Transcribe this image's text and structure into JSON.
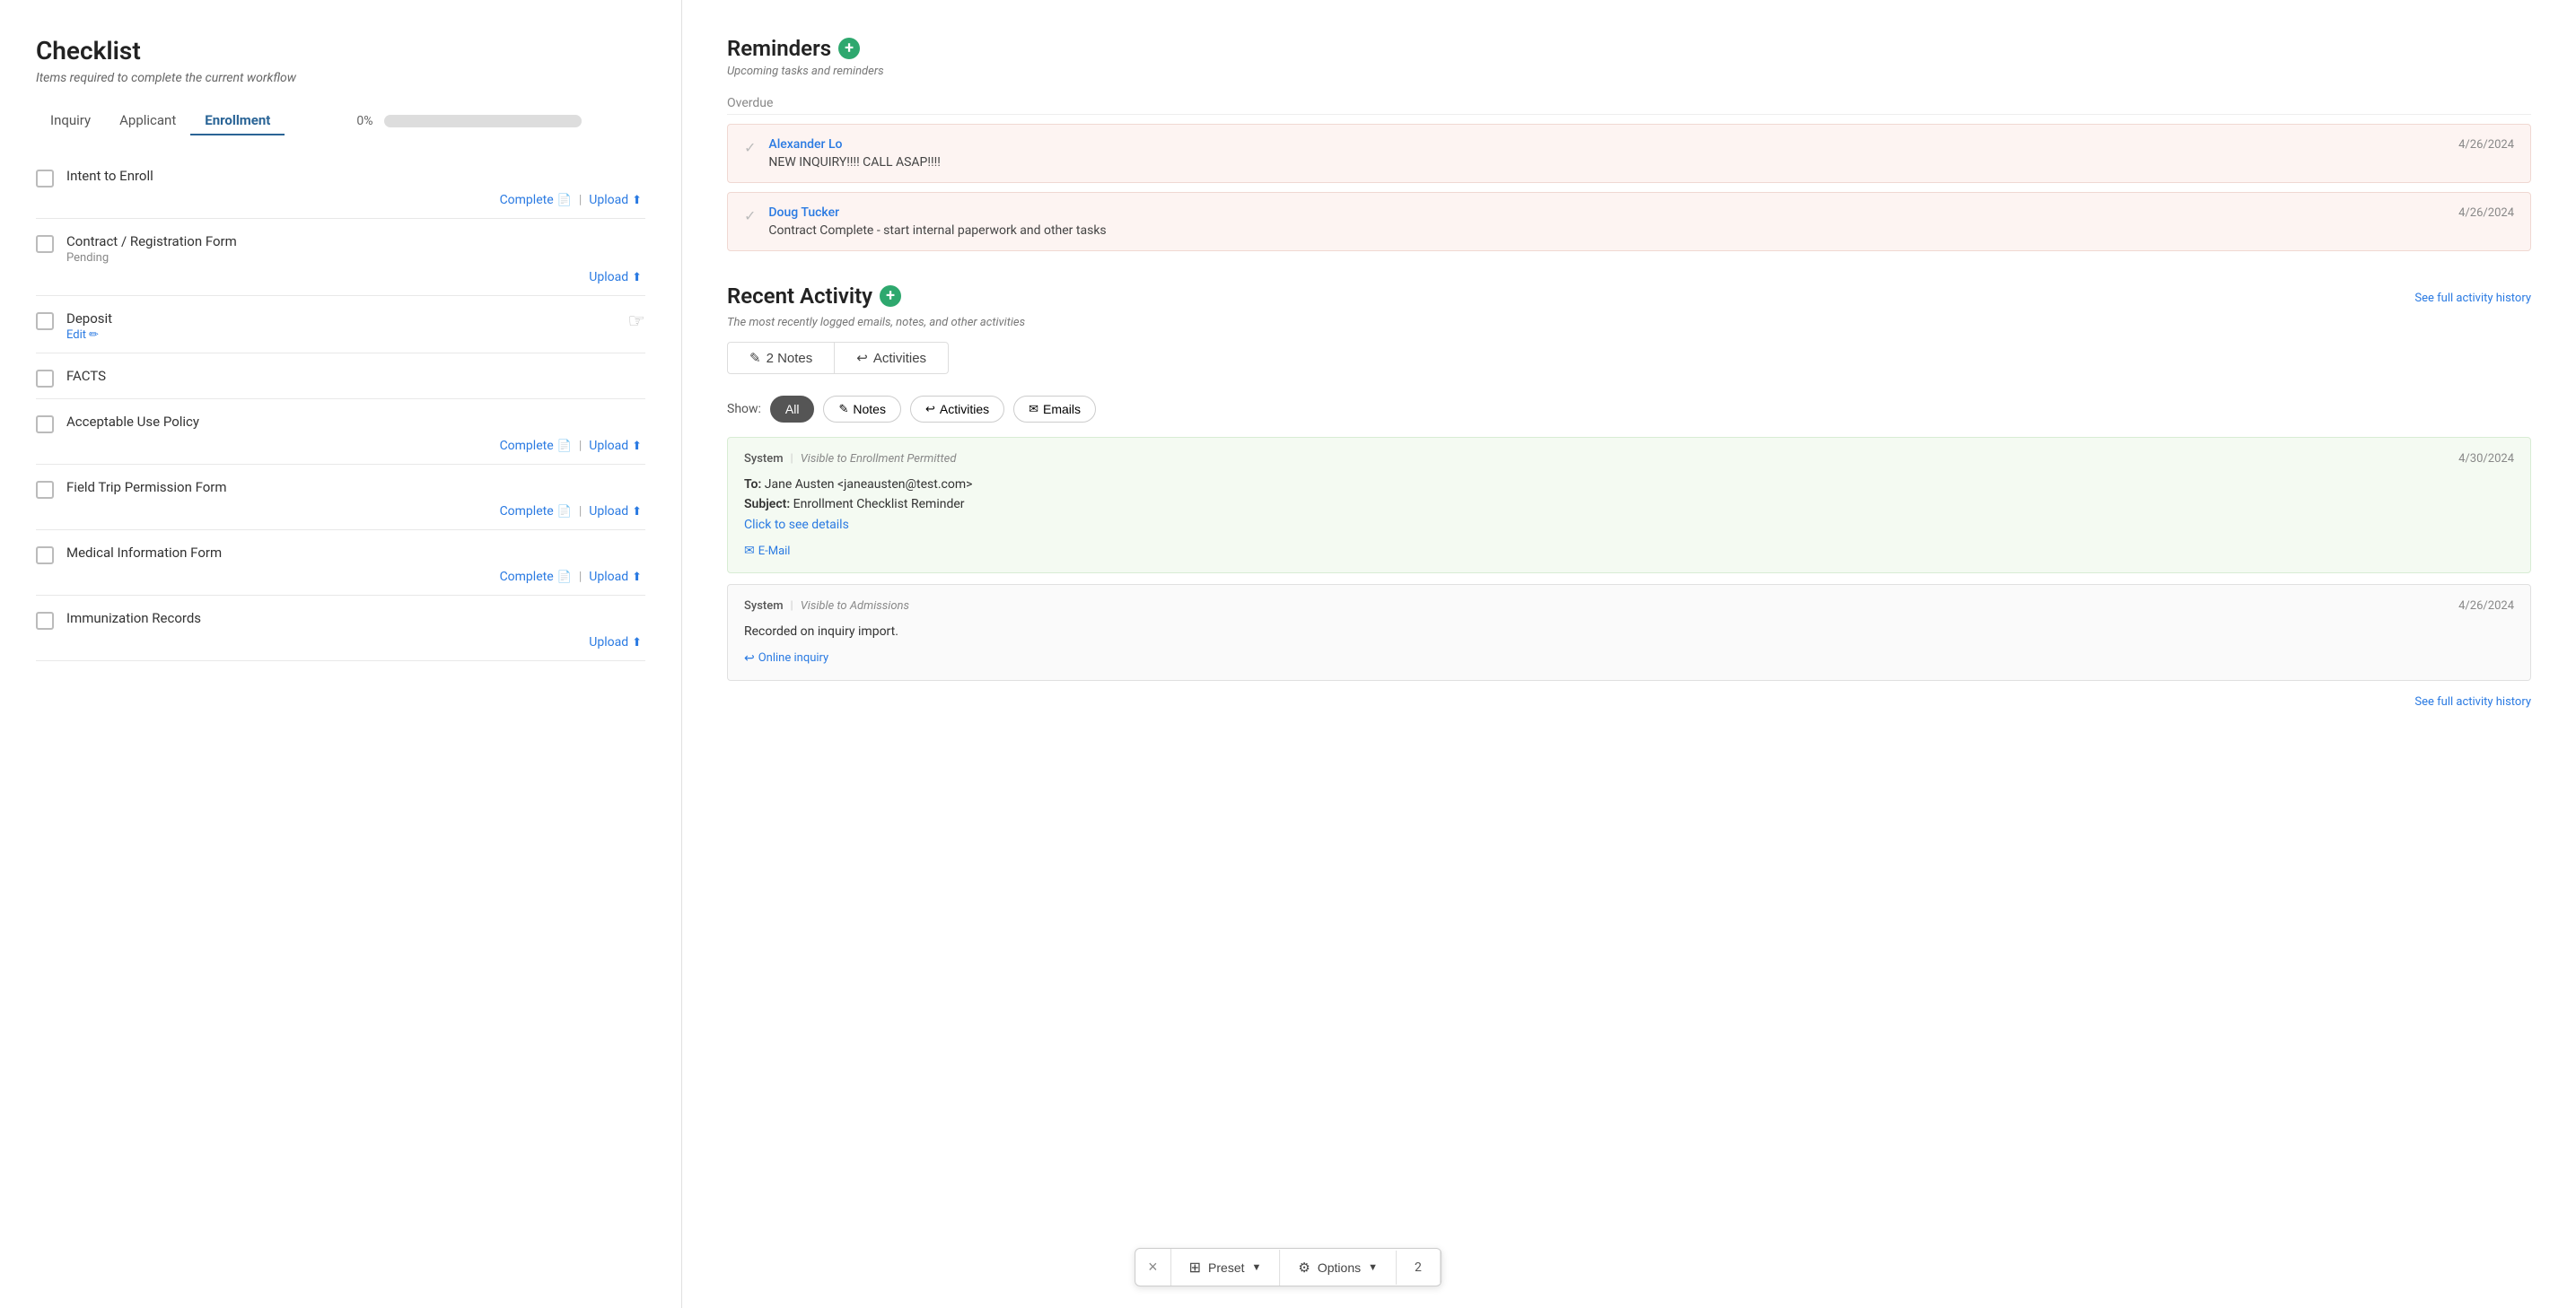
{
  "checklist": {
    "title": "Checklist",
    "subtitle": "Items required to complete the current workflow",
    "tabs": [
      {
        "id": "inquiry",
        "label": "Inquiry",
        "active": false
      },
      {
        "id": "applicant",
        "label": "Applicant",
        "active": false
      },
      {
        "id": "enrollment",
        "label": "Enrollment",
        "active": true
      }
    ],
    "progress": {
      "label": "0%",
      "value": 0
    },
    "items": [
      {
        "id": "intent-to-enroll",
        "name": "Intent to Enroll",
        "status": "",
        "actions": [
          "complete",
          "upload"
        ]
      },
      {
        "id": "contract-registration",
        "name": "Contract / Registration Form",
        "status": "Pending",
        "actions": [
          "upload"
        ]
      },
      {
        "id": "deposit",
        "name": "Deposit",
        "status": "",
        "actions": [
          "edit"
        ]
      },
      {
        "id": "facts",
        "name": "FACTS",
        "status": "",
        "actions": []
      },
      {
        "id": "acceptable-use",
        "name": "Acceptable Use Policy",
        "status": "",
        "actions": [
          "complete",
          "upload"
        ]
      },
      {
        "id": "field-trip",
        "name": "Field Trip Permission Form",
        "status": "",
        "actions": [
          "complete",
          "upload"
        ]
      },
      {
        "id": "medical-info",
        "name": "Medical Information Form",
        "status": "",
        "actions": [
          "complete",
          "upload"
        ]
      },
      {
        "id": "immunization",
        "name": "Immunization Records",
        "status": "",
        "actions": [
          "upload"
        ]
      }
    ],
    "action_labels": {
      "complete": "Complete",
      "upload": "Upload",
      "edit": "Edit"
    }
  },
  "toolbar": {
    "close_label": "×",
    "preset_label": "Preset",
    "options_label": "Options",
    "page_number": "2"
  },
  "reminders": {
    "title": "Reminders",
    "subtitle": "Upcoming tasks and reminders",
    "overdue_label": "Overdue",
    "items": [
      {
        "id": "reminder-1",
        "person": "Alexander Lo",
        "date": "4/26/2024",
        "text": "NEW INQUIRY!!!! CALL ASAP!!!!"
      },
      {
        "id": "reminder-2",
        "person": "Doug Tucker",
        "date": "4/26/2024",
        "text": "Contract Complete - start internal paperwork and other tasks"
      }
    ]
  },
  "recent_activity": {
    "title": "Recent Activity",
    "subtitle": "The most recently logged emails, notes, and other activities",
    "see_history": "See full activity history",
    "show_label": "Show:",
    "filters": [
      {
        "id": "all",
        "label": "All",
        "active": true,
        "icon": ""
      },
      {
        "id": "notes",
        "label": "Notes",
        "active": false,
        "icon": "✎"
      },
      {
        "id": "activities",
        "label": "Activities",
        "active": false,
        "icon": "↩"
      },
      {
        "id": "emails",
        "label": "Emails",
        "active": false,
        "icon": "✉"
      }
    ],
    "notes_count": "2 Notes",
    "activities_label": "Activities",
    "activities": [
      {
        "id": "activity-1",
        "source": "System",
        "visibility": "Visible to Enrollment Permitted",
        "date": "4/30/2024",
        "to": "Jane Austen <janeausten@test.com>",
        "subject": "Enrollment Checklist Reminder",
        "click_details": "Click to see details",
        "type": "E-Mail",
        "type_icon": "✉",
        "bg": "green"
      },
      {
        "id": "activity-2",
        "source": "System",
        "visibility": "Visible to Admissions",
        "date": "4/26/2024",
        "text": "Recorded on inquiry import.",
        "type": "Online inquiry",
        "type_icon": "↩",
        "bg": "gray"
      }
    ],
    "see_history_bottom": "See full activity history"
  }
}
